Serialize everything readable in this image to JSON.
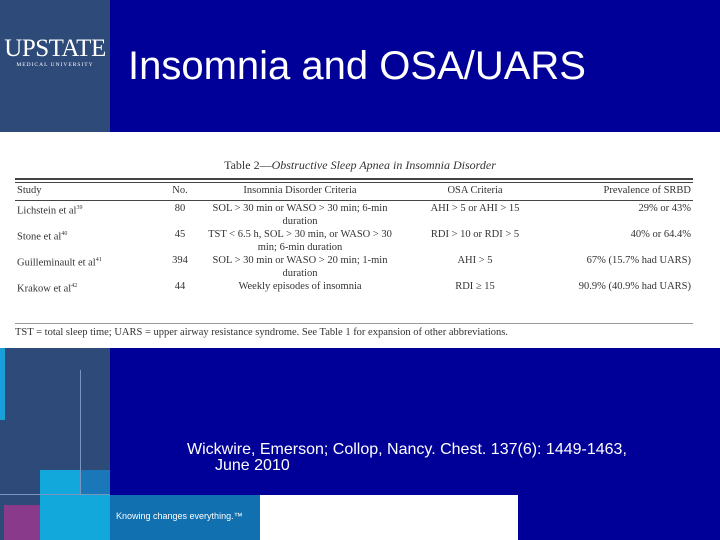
{
  "logo": {
    "name": "UPSTATE",
    "sub": "MEDICAL UNIVERSITY"
  },
  "title": "Insomnia and OSA/UARS",
  "table": {
    "caption_prefix": "Table 2—",
    "caption_title": "Obstructive Sleep Apnea in Insomnia Disorder",
    "headers": [
      "Study",
      "No.",
      "Insomnia Disorder Criteria",
      "OSA Criteria",
      "Prevalence of SRBD"
    ],
    "rows": [
      {
        "study": "Lichstein et al",
        "ref": "39",
        "no": "80",
        "criteria": "SOL > 30 min or WASO > 30 min; 6-min duration",
        "osa": "AHI > 5 or AHI > 15",
        "prev": "29% or 43%"
      },
      {
        "study": "Stone et al",
        "ref": "40",
        "no": "45",
        "criteria": "TST < 6.5 h, SOL > 30 min, or WASO > 30 min; 6-min duration",
        "osa": "RDI > 10 or RDI > 5",
        "prev": "40% or 64.4%"
      },
      {
        "study": "Guilleminault et al",
        "ref": "41",
        "no": "394",
        "criteria": "SOL > 30 min or WASO > 20 min; 1-min duration",
        "osa": "AHI > 5",
        "prev": "67% (15.7% had UARS)"
      },
      {
        "study": "Krakow et al",
        "ref": "42",
        "no": "44",
        "criteria": "Weekly episodes of insomnia",
        "osa": "RDI ≥ 15",
        "prev": "90.9% (40.9% had UARS)"
      }
    ],
    "footnote": "TST = total sleep time; UARS = upper airway resistance syndrome. See Table 1 for expansion of other abbreviations."
  },
  "citation": {
    "line1": "Wickwire, Emerson; Collop, Nancy. Chest. 137(6): 1449-1463,",
    "line2": "June 2010"
  },
  "tagline": "Knowing changes everything.™"
}
